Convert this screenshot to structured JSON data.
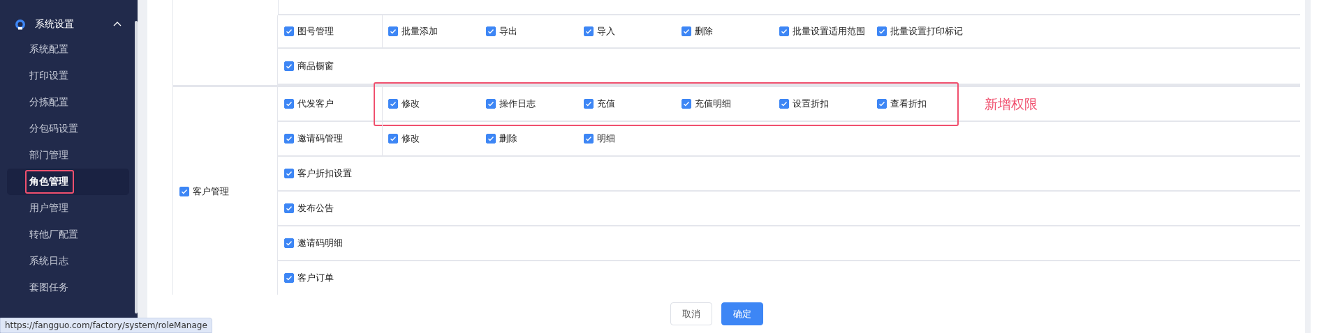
{
  "sidebar": {
    "section": {
      "label": "系统设置",
      "expanded": true
    },
    "items": [
      {
        "label": "系统配置",
        "selected": false
      },
      {
        "label": "打印设置",
        "selected": false
      },
      {
        "label": "分拣配置",
        "selected": false
      },
      {
        "label": "分包码设置",
        "selected": false
      },
      {
        "label": "部门管理",
        "selected": false
      },
      {
        "label": "角色管理",
        "selected": true
      },
      {
        "label": "用户管理",
        "selected": false
      },
      {
        "label": "转他厂配置",
        "selected": false
      },
      {
        "label": "系统日志",
        "selected": false
      },
      {
        "label": "套图任务",
        "selected": false
      }
    ]
  },
  "permissions": [
    {
      "rows": [
        {
          "label": "图号管理",
          "checked": true,
          "actions": [
            {
              "label": "批量添加",
              "checked": true
            },
            {
              "label": "导出",
              "checked": true
            },
            {
              "label": "导入",
              "checked": true
            },
            {
              "label": "删除",
              "checked": true
            },
            {
              "label": "批量设置适用范围",
              "checked": true
            },
            {
              "label": "批量设置打印标记",
              "checked": true
            }
          ]
        },
        {
          "label": "商品橱窗",
          "checked": true,
          "actions": []
        }
      ]
    },
    {
      "label": "客户管理",
      "checked": true,
      "rows": [
        {
          "label": "代发客户",
          "checked": true,
          "highlighted": true,
          "actions": [
            {
              "label": "修改",
              "checked": true
            },
            {
              "label": "操作日志",
              "checked": true
            },
            {
              "label": "充值",
              "checked": true
            },
            {
              "label": "充值明细",
              "checked": true
            },
            {
              "label": "设置折扣",
              "checked": true
            },
            {
              "label": "查看折扣",
              "checked": true
            }
          ]
        },
        {
          "label": "邀请码管理",
          "checked": true,
          "actions": [
            {
              "label": "修改",
              "checked": true
            },
            {
              "label": "删除",
              "checked": true
            },
            {
              "label": "明细",
              "checked": true
            }
          ]
        },
        {
          "label": "客户折扣设置",
          "checked": true,
          "actions": []
        },
        {
          "label": "发布公告",
          "checked": true,
          "actions": []
        },
        {
          "label": "邀请码明细",
          "checked": true,
          "actions": []
        },
        {
          "label": "客户订单",
          "checked": true,
          "actions": []
        }
      ]
    }
  ],
  "annotation": {
    "label": "新增权限"
  },
  "buttons": [
    {
      "label": "取消",
      "kind": "secondary"
    },
    {
      "label": "确定",
      "kind": "primary"
    }
  ],
  "status_url": "https://fangguo.com/factory/system/roleManage"
}
